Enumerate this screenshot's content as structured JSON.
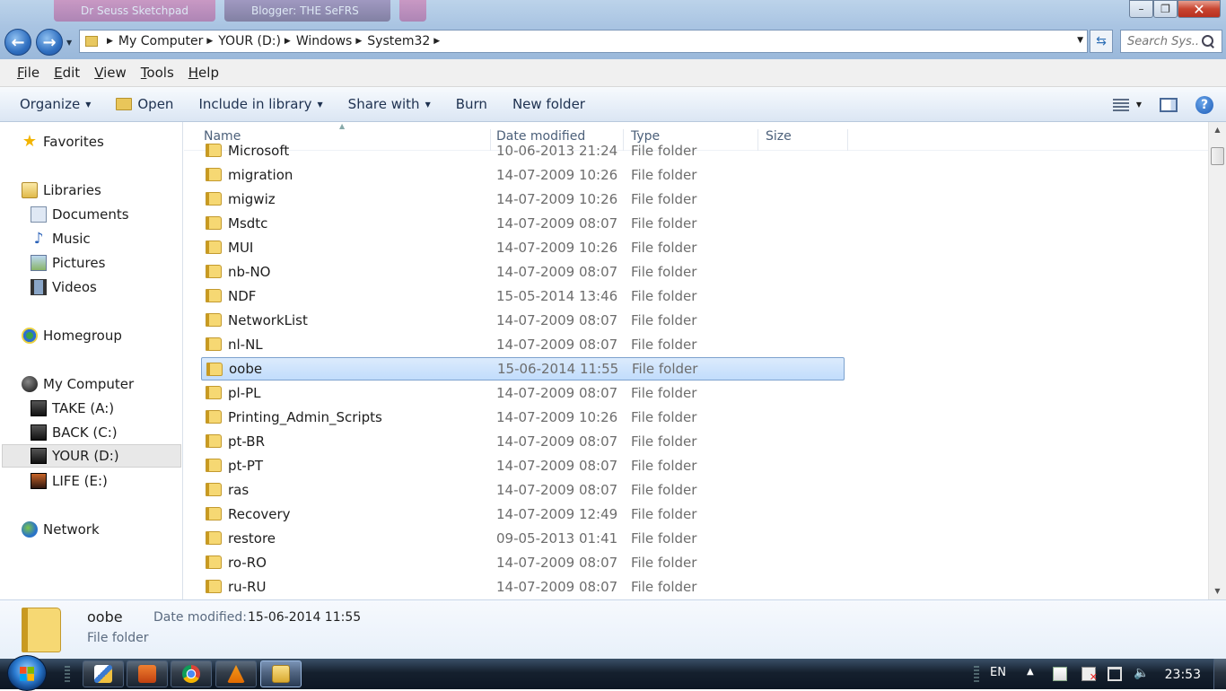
{
  "window": {
    "background_tabs": [
      "Dr Seuss Sketchpad",
      "Blogger: THE SeFRS"
    ],
    "controls": {
      "minimize": "–",
      "restore": "❐",
      "close": "✕"
    }
  },
  "navigation": {
    "back": "←",
    "forward": "→"
  },
  "address": {
    "crumbs": [
      "My Computer",
      "YOUR (D:)",
      "Windows",
      "System32"
    ]
  },
  "search": {
    "placeholder": "Search Sys..."
  },
  "menu": [
    "File",
    "Edit",
    "View",
    "Tools",
    "Help"
  ],
  "toolbar": {
    "organize": "Organize",
    "open": "Open",
    "include": "Include in library",
    "share": "Share with",
    "burn": "Burn",
    "new_folder": "New folder",
    "help": "?"
  },
  "nav_pane": {
    "favorites": "Favorites",
    "libraries": "Libraries",
    "documents": "Documents",
    "music": "Music",
    "pictures": "Pictures",
    "videos": "Videos",
    "homegroup": "Homegroup",
    "my_computer": "My Computer",
    "drives": [
      "TAKE (A:)",
      "BACK (C:)",
      "YOUR (D:)",
      "LIFE (E:)"
    ],
    "network": "Network"
  },
  "columns": {
    "name": "Name",
    "date": "Date modified",
    "type": "Type",
    "size": "Size"
  },
  "files": [
    {
      "name": "Microsoft",
      "date": "10-06-2013 21:24",
      "type": "File folder"
    },
    {
      "name": "migration",
      "date": "14-07-2009 10:26",
      "type": "File folder"
    },
    {
      "name": "migwiz",
      "date": "14-07-2009 10:26",
      "type": "File folder"
    },
    {
      "name": "Msdtc",
      "date": "14-07-2009 08:07",
      "type": "File folder"
    },
    {
      "name": "MUI",
      "date": "14-07-2009 10:26",
      "type": "File folder"
    },
    {
      "name": "nb-NO",
      "date": "14-07-2009 08:07",
      "type": "File folder"
    },
    {
      "name": "NDF",
      "date": "15-05-2014 13:46",
      "type": "File folder"
    },
    {
      "name": "NetworkList",
      "date": "14-07-2009 08:07",
      "type": "File folder"
    },
    {
      "name": "nl-NL",
      "date": "14-07-2009 08:07",
      "type": "File folder"
    },
    {
      "name": "oobe",
      "date": "15-06-2014 11:55",
      "type": "File folder"
    },
    {
      "name": "pl-PL",
      "date": "14-07-2009 08:07",
      "type": "File folder"
    },
    {
      "name": "Printing_Admin_Scripts",
      "date": "14-07-2009 10:26",
      "type": "File folder"
    },
    {
      "name": "pt-BR",
      "date": "14-07-2009 08:07",
      "type": "File folder"
    },
    {
      "name": "pt-PT",
      "date": "14-07-2009 08:07",
      "type": "File folder"
    },
    {
      "name": "ras",
      "date": "14-07-2009 08:07",
      "type": "File folder"
    },
    {
      "name": "Recovery",
      "date": "14-07-2009 12:49",
      "type": "File folder"
    },
    {
      "name": "restore",
      "date": "09-05-2013 01:41",
      "type": "File folder"
    },
    {
      "name": "ro-RO",
      "date": "14-07-2009 08:07",
      "type": "File folder"
    },
    {
      "name": "ru-RU",
      "date": "14-07-2009 08:07",
      "type": "File folder"
    }
  ],
  "selected_index": 9,
  "details": {
    "name": "oobe",
    "date_label": "Date modified:",
    "date_value": "15-06-2014 11:55",
    "type": "File folder"
  },
  "taskbar": {
    "language": "EN",
    "clock": "23:53"
  },
  "colors": {
    "accent": "#2f6fc0",
    "selection": "#c1dcfc",
    "taskbar": "#15202e"
  }
}
